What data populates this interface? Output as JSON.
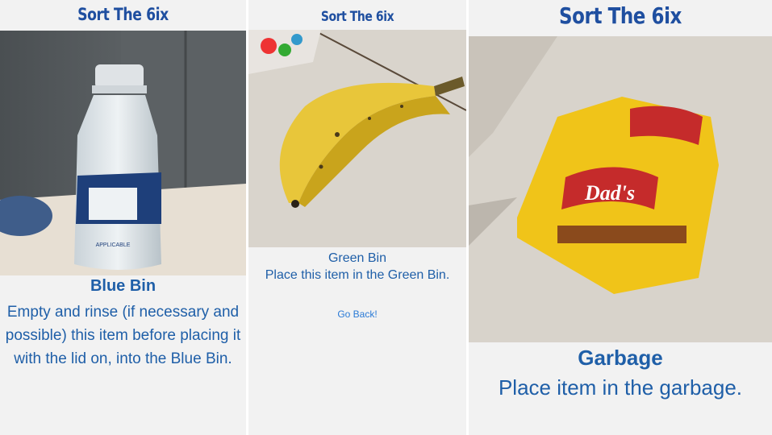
{
  "app": {
    "title": "Sort The 6ix"
  },
  "screens": [
    {
      "title": "Sort The 6ix",
      "photo": {
        "subject": "plastic water bottle",
        "label_text": "APPLICABLE"
      },
      "bin": "Blue Bin",
      "instructions": "Empty and rinse (if necessary and possible) this item before placing it with the lid on, into the Blue Bin."
    },
    {
      "title": "Sort The 6ix",
      "photo": {
        "subject": "banana peel"
      },
      "bin": "Green Bin",
      "instructions": "Place this item in the Green Bin.",
      "back_label": "Go Back!"
    },
    {
      "title": "Sort The 6ix",
      "photo": {
        "subject": "cookie wrapper",
        "brand_text": "Dad's"
      },
      "bin": "Garbage",
      "instructions": "Place item in the garbage."
    }
  ],
  "colors": {
    "title": "#1f4fa0",
    "text": "#1f5fa8",
    "link": "#2a7ad6",
    "background": "#f2f2f2"
  }
}
